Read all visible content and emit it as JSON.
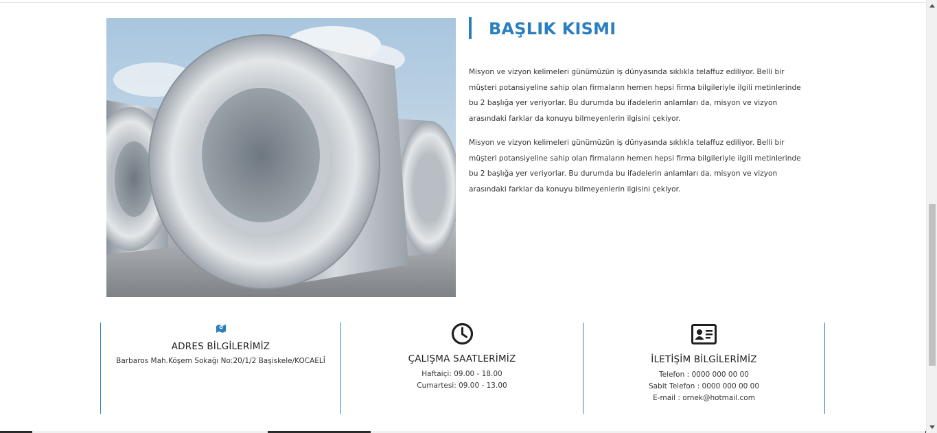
{
  "section": {
    "heading": "BAŞLIK KISMI",
    "paragraphs": [
      "Misyon ve vizyon kelimeleri günümüzün iş dünyasında sıklıkla telaffuz ediliyor. Belli bir müşteri potansiyeline sahip olan firmaların hemen hepsi firma bilgileriyle ilgili metinlerinde bu 2 başlığa yer veriyorlar. Bu durumda bu ifadelerin anlamları da, misyon ve vizyon arasındaki farklar da konuyu bilmeyenlerin ilgisini çekiyor.",
      "Misyon ve vizyon kelimeleri günümüzün iş dünyasında sıklıkla telaffuz ediliyor. Belli bir müşteri potansiyeline sahip olan firmaların hemen hepsi firma bilgileriyle ilgili metinlerinde bu 2 başlığa yer veriyorlar. Bu durumda bu ifadelerin anlamları da, misyon ve vizyon arasındaki farklar da konuyu bilmeyenlerin ilgisini çekiyor."
    ],
    "image_icon": "steel-coils-photo"
  },
  "info": {
    "address": {
      "icon": "map-icon",
      "title": "ADRES BİLGİLERİMİZ",
      "lines": [
        "Barbaros Mah.Köşem Sokağı No:20/1/2 Başiskele/KOCAELİ"
      ]
    },
    "hours": {
      "icon": "clock-icon",
      "title": "ÇALIŞMA SAATLERİMİZ",
      "lines": [
        "Haftaiçi: 09.00 - 18.00",
        "Cumartesi: 09.00 - 13.00"
      ]
    },
    "contact": {
      "icon": "contact-card-icon",
      "title": "İLETİŞİM BİLGİLERİMİZ",
      "lines": [
        "Telefon : 0000 000 00 00",
        "Sabit Telefon : 0000 000 00 00",
        "E-mail : ornek@hotmail.com"
      ]
    }
  },
  "colors": {
    "accent": "#2a7fc0",
    "text": "#333333",
    "background": "#ffffff"
  }
}
